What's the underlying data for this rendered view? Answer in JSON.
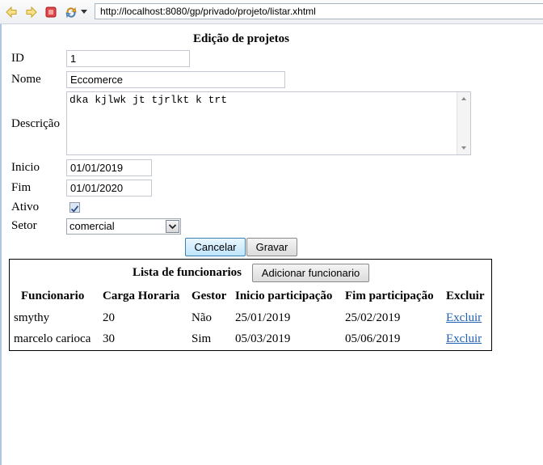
{
  "browser": {
    "url": "http://localhost:8080/gp/privado/projeto/listar.xhtml"
  },
  "form": {
    "title": "Edição de projetos",
    "fields": {
      "id": {
        "label": "ID",
        "value": "1"
      },
      "nome": {
        "label": "Nome",
        "value": "Eccomerce"
      },
      "descricao": {
        "label": "Descrição",
        "value": "dka kjlwk jt tjrlkt k trt"
      },
      "inicio": {
        "label": "Inicio",
        "value": "01/01/2019"
      },
      "fim": {
        "label": "Fim",
        "value": "01/01/2020"
      },
      "ativo": {
        "label": "Ativo",
        "checked": true
      },
      "setor": {
        "label": "Setor",
        "value": "comercial"
      }
    },
    "buttons": {
      "cancel": "Cancelar",
      "save": "Gravar"
    }
  },
  "employees": {
    "title": "Lista de funcionarios",
    "add_button": "Adicionar funcionario",
    "headers": [
      "Funcionario",
      "Carga Horaria",
      "Gestor",
      "Inicio participação",
      "Fim participação",
      "Excluir"
    ],
    "rows": [
      [
        "smythy",
        "20",
        "Não",
        "25/01/2019",
        "25/02/2019",
        "Excluir"
      ],
      [
        "marcelo carioca",
        "30",
        "Sim",
        "05/03/2019",
        "05/06/2019",
        "Excluir"
      ]
    ]
  }
}
